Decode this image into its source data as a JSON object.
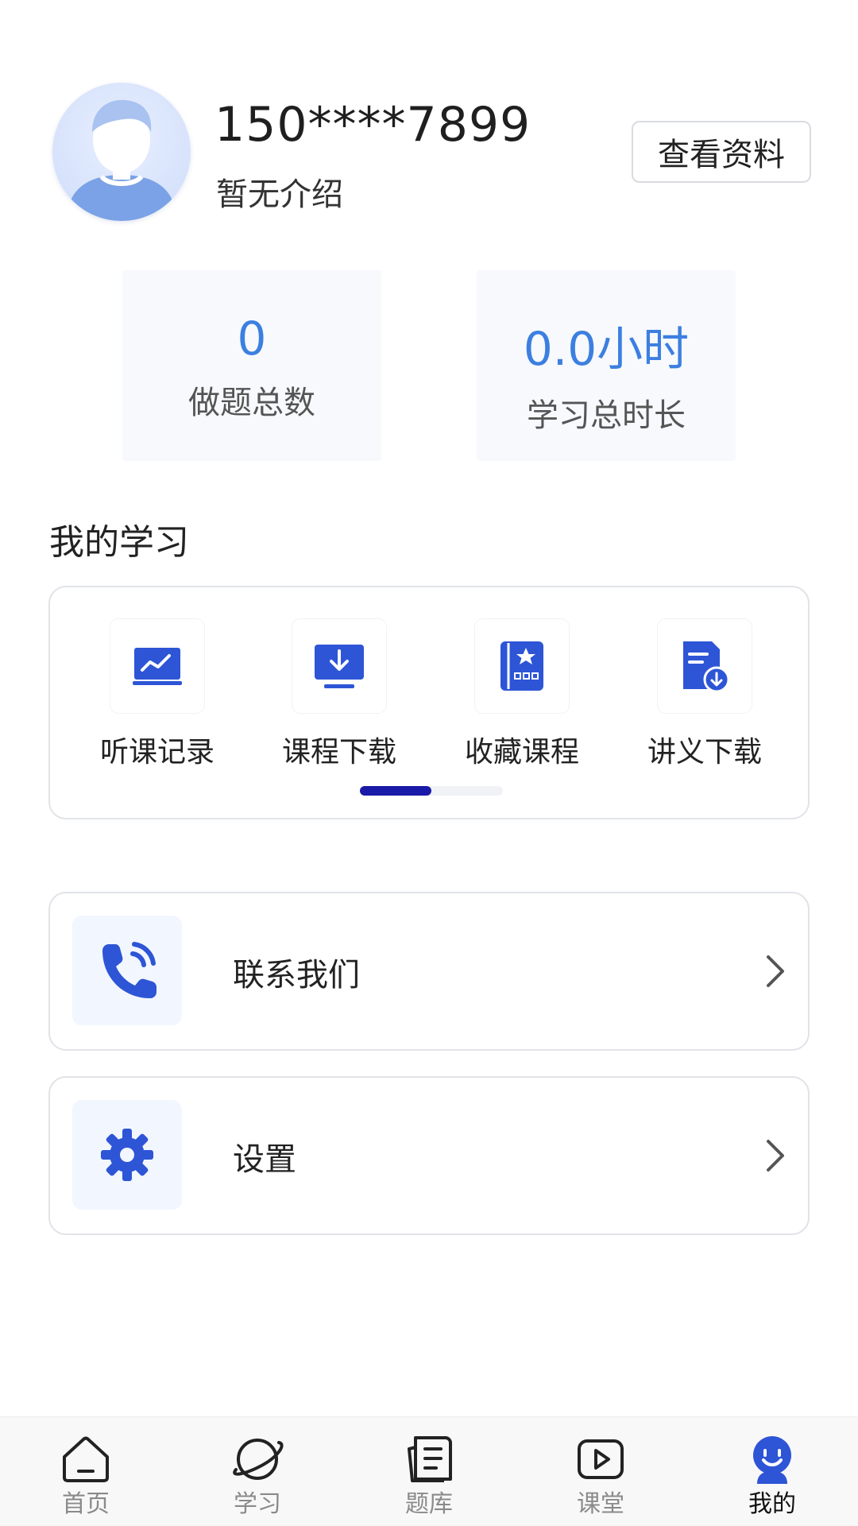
{
  "profile": {
    "phone": "150****7899",
    "intro": "暂无介绍",
    "view_profile_label": "查看资料"
  },
  "stats": [
    {
      "value": "0",
      "label": "做题总数"
    },
    {
      "value": "0.0小时",
      "label": "学习总时长"
    }
  ],
  "my_study": {
    "title": "我的学习",
    "items": [
      {
        "label": "听课记录",
        "icon": "chart-screen-icon"
      },
      {
        "label": "课程下载",
        "icon": "download-screen-icon"
      },
      {
        "label": "收藏课程",
        "icon": "star-book-icon"
      },
      {
        "label": "讲义下载",
        "icon": "document-download-icon"
      }
    ],
    "scroll_progress": 0.5
  },
  "list": {
    "contact_label": "联系我们",
    "settings_label": "设置"
  },
  "bottom_nav": {
    "items": [
      {
        "label": "首页",
        "icon": "home-icon"
      },
      {
        "label": "学习",
        "icon": "planet-icon"
      },
      {
        "label": "题库",
        "icon": "question-bank-icon"
      },
      {
        "label": "课堂",
        "icon": "video-play-icon"
      },
      {
        "label": "我的",
        "icon": "profile-face-icon"
      }
    ],
    "active_index": 4
  },
  "colors": {
    "accent_blue": "#2d55d6",
    "stat_blue": "#3c7fe0",
    "scroll_thumb": "#1a1aa8"
  }
}
